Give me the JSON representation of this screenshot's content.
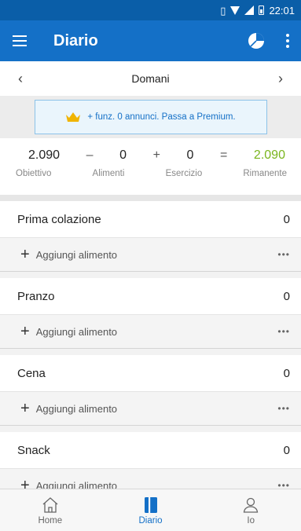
{
  "statusbar": {
    "time": "22:01"
  },
  "appbar": {
    "title": "Diario"
  },
  "datebar": {
    "label": "Domani",
    "prev": "‹",
    "next": "›"
  },
  "promo": {
    "text": "+ funz. 0 annunci. Passa a Premium."
  },
  "summary": {
    "goal": "2.090",
    "minus": "–",
    "food": "0",
    "plus": "+",
    "exercise": "0",
    "equals": "=",
    "remaining": "2.090",
    "goal_label": "Obiettivo",
    "food_label": "Alimenti",
    "exercise_label": "Esercizio",
    "remaining_label": "Rimanente",
    "remaining_color": "#7ab51d"
  },
  "meals": [
    {
      "name": "Prima colazione",
      "calories": "0",
      "add_label": "Aggiungi alimento",
      "more": "•••"
    },
    {
      "name": "Pranzo",
      "calories": "0",
      "add_label": "Aggiungi alimento",
      "more": "•••"
    },
    {
      "name": "Cena",
      "calories": "0",
      "add_label": "Aggiungi alimento",
      "more": "•••"
    },
    {
      "name": "Snack",
      "calories": "0",
      "add_label": "Aggiungi alimento",
      "more": "•••"
    }
  ],
  "bottomnav": {
    "home": "Home",
    "diary": "Diario",
    "me": "Io"
  },
  "colors": {
    "primary": "#1470c7",
    "statusbar": "#0a5ea8",
    "accent_green": "#7ab51d",
    "crown": "#f0b400"
  }
}
